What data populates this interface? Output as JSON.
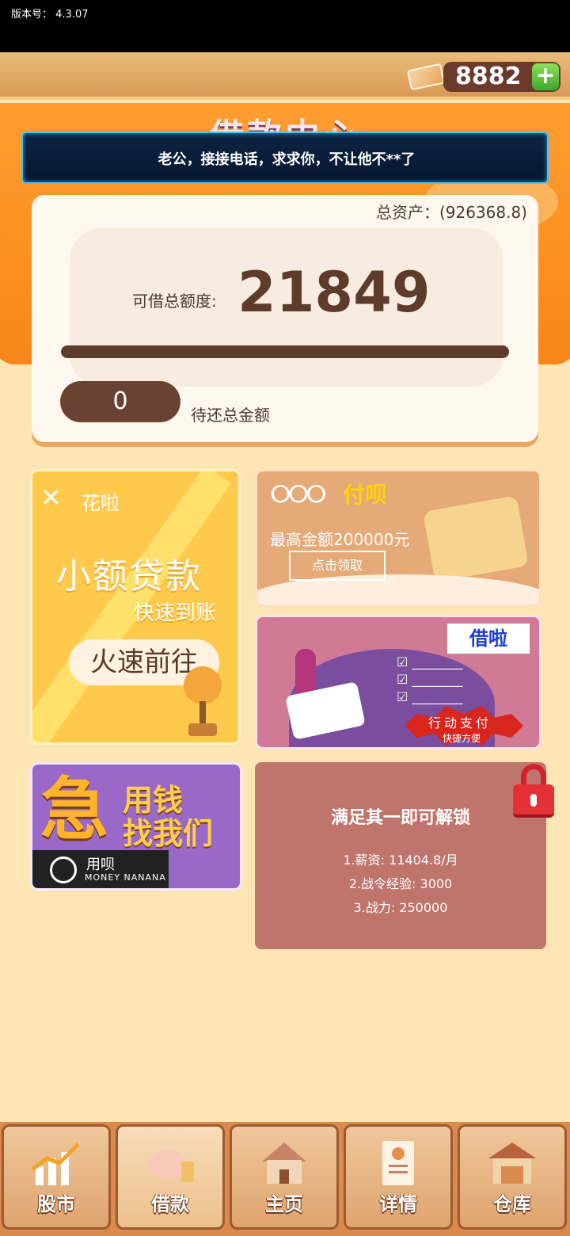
{
  "status_bar": {
    "version_label": "版本号：",
    "version": "4.3.07"
  },
  "currency": {
    "amount": "8882",
    "plus_label": "+"
  },
  "page": {
    "title": "借款中心",
    "notice": "老公，接接电话，求求你，不让他不**了"
  },
  "assets": {
    "total_label": "总资产：(926368.8)",
    "limit_label": "可借总额度:",
    "limit_value": "21849",
    "limit_progress": 1.0,
    "repay_value": "0",
    "repay_label": "待还总金额"
  },
  "cards": {
    "huala": {
      "logo": "✕",
      "brand": "花啦",
      "title": "小额贷款",
      "subtitle": "快速到账",
      "button": "火速前往"
    },
    "fubei": {
      "rings": "ⵔⵔⵔ",
      "brand": "付呗",
      "amount": "最高金额200000元",
      "button": "点击领取"
    },
    "jiela": {
      "brand": "借啦",
      "checks": [
        "☑ ________",
        "☑ ________",
        "☑ ________"
      ],
      "pay": "行动支付",
      "fast": "快捷方便"
    },
    "yongbei": {
      "urgent": "急",
      "line1": "用钱",
      "line2": "找我们",
      "brand": "用呗",
      "en": "MONEY NANANA"
    },
    "locked": {
      "title": "满足其一即可解锁",
      "conditions": [
        "1.薪资: 11404.8/月",
        "2.战令经验: 3000",
        "3.战力: 250000"
      ]
    }
  },
  "nav": [
    {
      "label": "股市",
      "icon": "stock-chart-icon"
    },
    {
      "label": "借款",
      "icon": "piggy-bank-icon"
    },
    {
      "label": "主页",
      "icon": "house-icon"
    },
    {
      "label": "详情",
      "icon": "profile-card-icon"
    },
    {
      "label": "仓库",
      "icon": "warehouse-icon"
    }
  ]
}
